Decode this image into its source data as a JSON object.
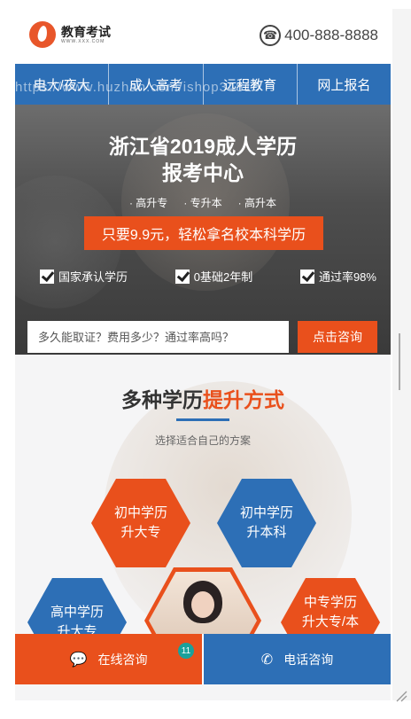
{
  "header": {
    "logo_title": "教育考试",
    "logo_subtitle": "WWW.XXX.COM",
    "phone": "400-888-8888"
  },
  "nav": {
    "items": [
      {
        "label": "电大/夜大"
      },
      {
        "label": "成人高考"
      },
      {
        "label": "远程教育"
      },
      {
        "label": "网上报名"
      }
    ]
  },
  "watermark": "https://www.huzhan.com/ishop34816",
  "hero": {
    "title_line1": "浙江省2019成人学历",
    "title_line2": "报考中心",
    "tags": [
      "高升专",
      "专升本",
      "高升本"
    ],
    "cta": "只要9.9元，轻松拿名校本科学历",
    "checks": [
      "国家承认学历",
      "0基础2年制",
      "通过率98%"
    ],
    "search_placeholder": "多久能取证？费用多少？通过率高吗？",
    "consult_button": "点击咨询"
  },
  "section": {
    "title_plain": "多种学历",
    "title_highlight": "提升方式",
    "subtitle": "选择适合自己的方案",
    "hexes": [
      {
        "label": "初中学历升大专",
        "color": "#e9501c"
      },
      {
        "label": "初中学历升本科",
        "color": "#2d6fb6"
      },
      {
        "label": "高中学历升大专",
        "color": "#2d6fb6"
      },
      {
        "label": "中专学历升大专/本科",
        "color": "#e9501c"
      }
    ]
  },
  "bottom_bar": {
    "online": "在线咨询",
    "badge": "11",
    "phone": "电话咨询"
  },
  "colors": {
    "brand_blue": "#2d6fb6",
    "brand_orange": "#e9501c",
    "badge_teal": "#1aa19b"
  }
}
